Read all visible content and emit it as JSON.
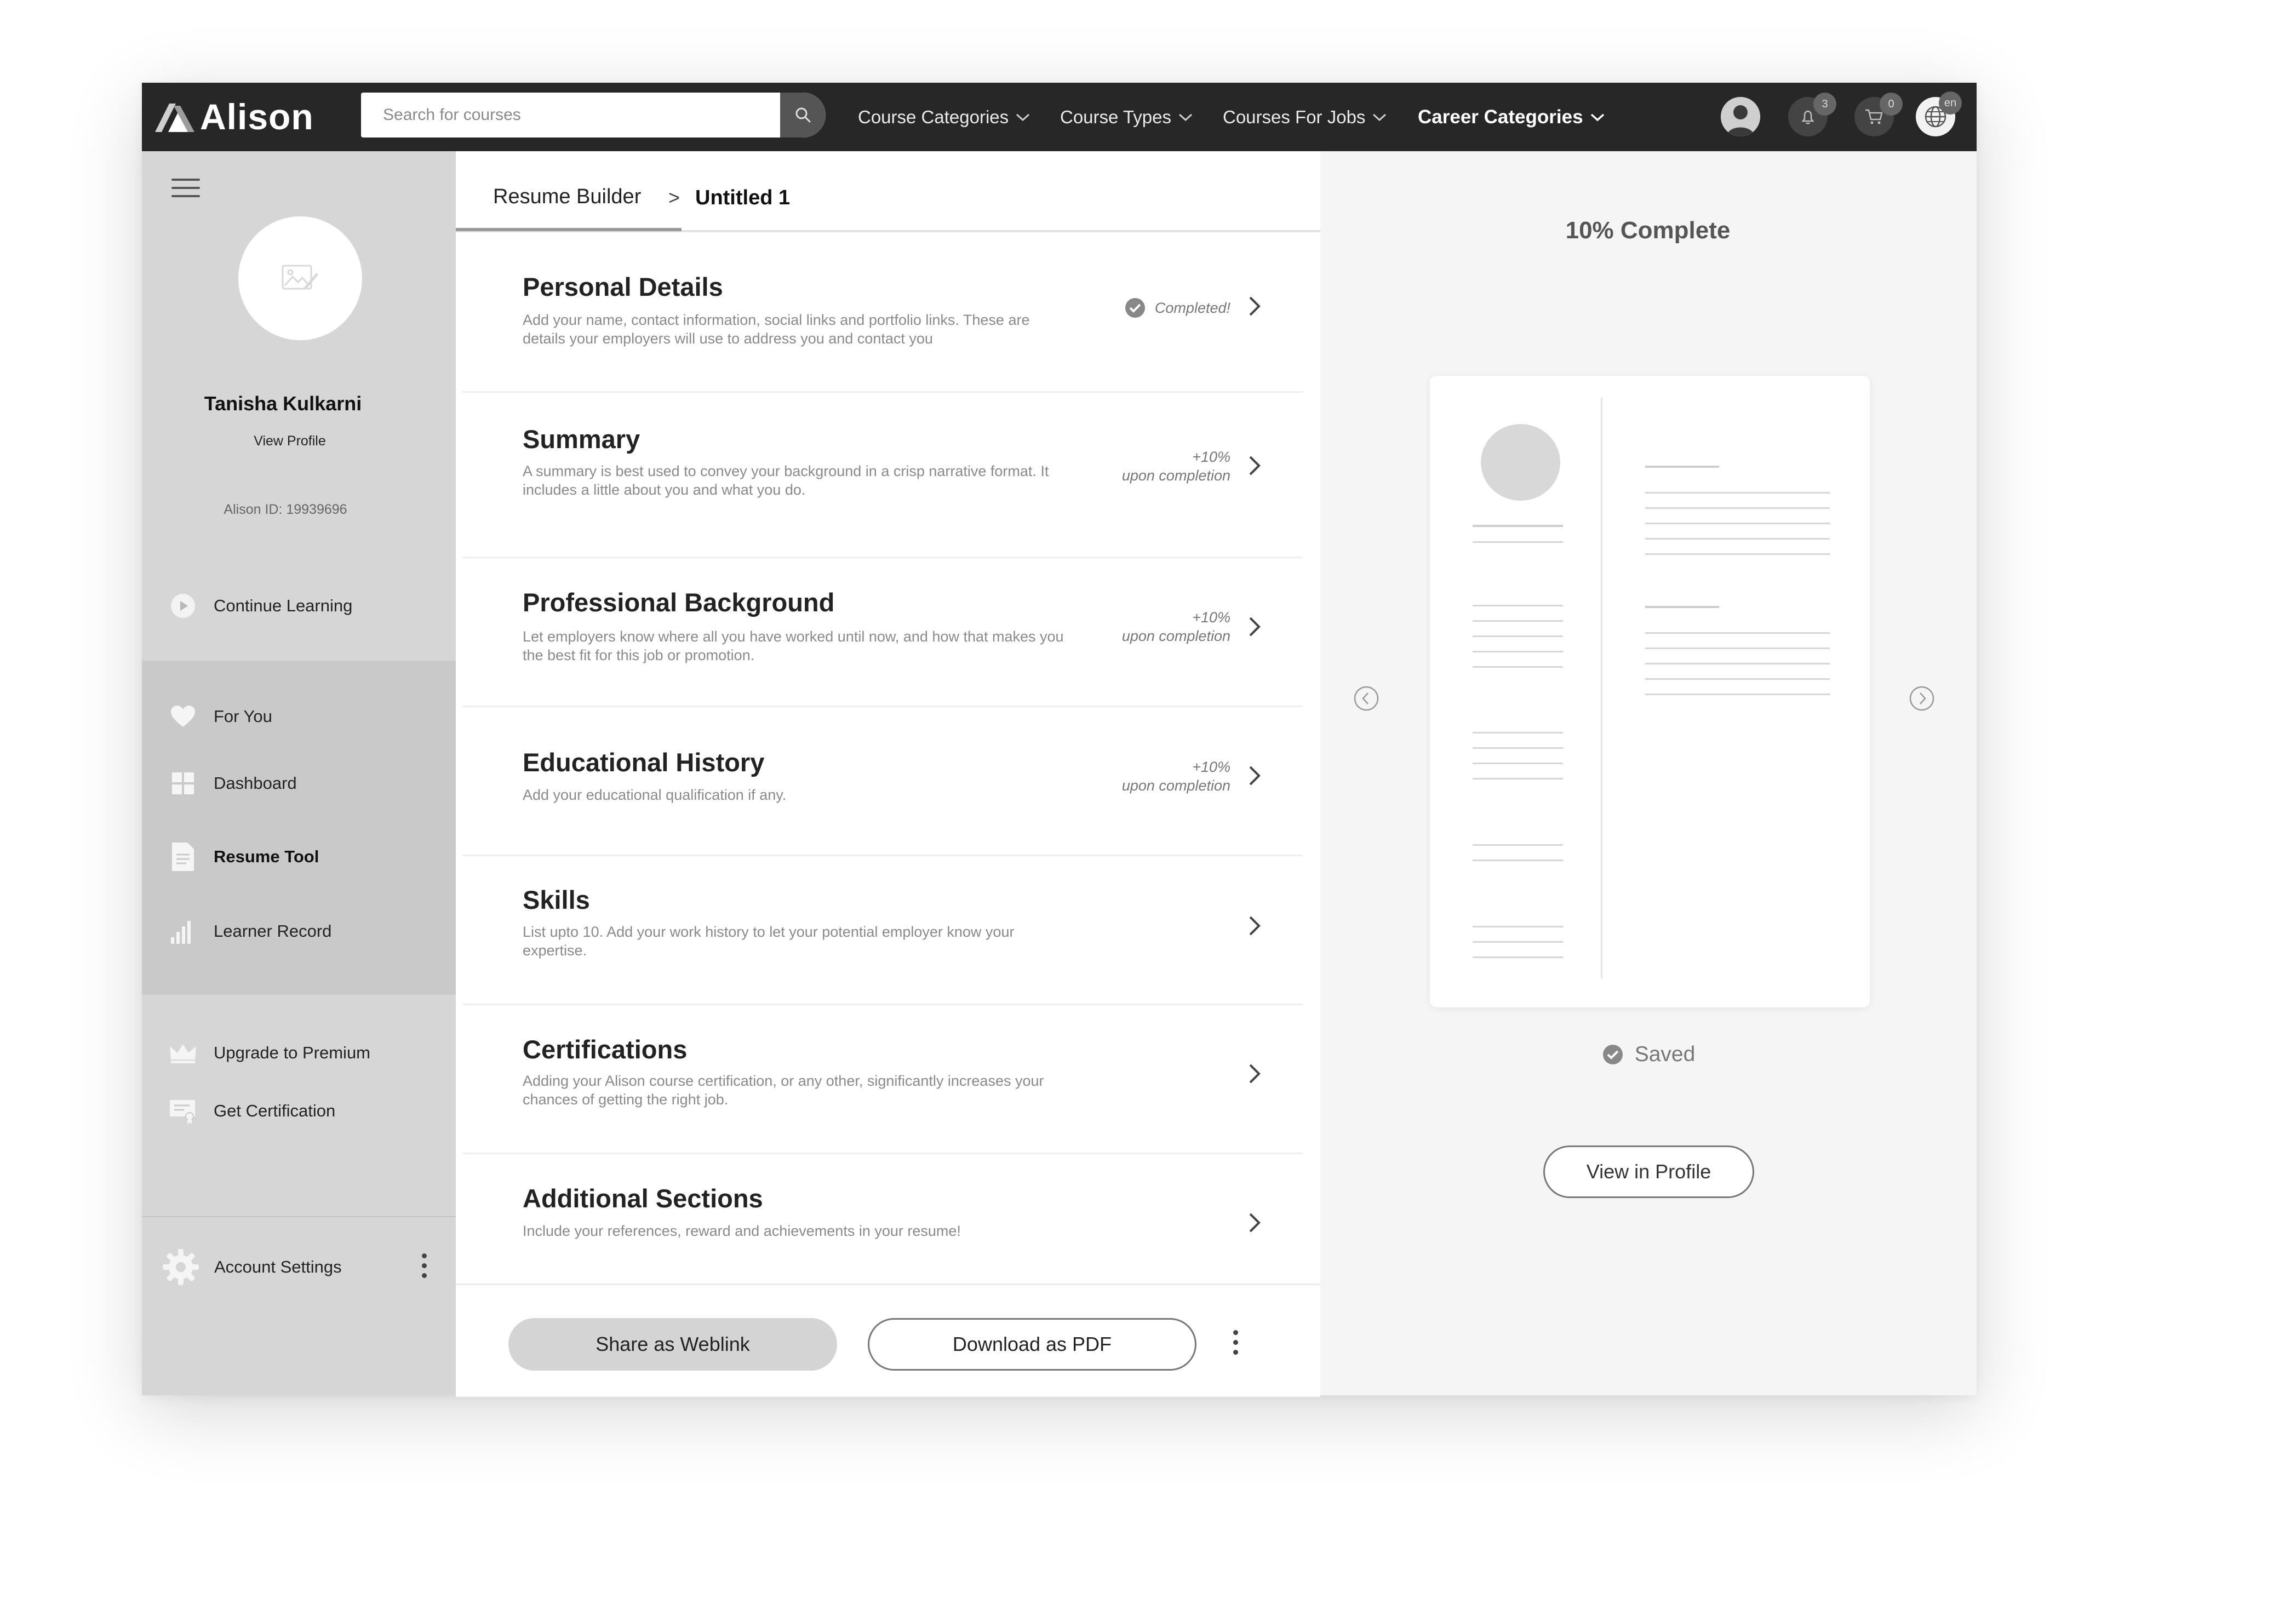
{
  "brand": {
    "name": "Alison"
  },
  "search": {
    "placeholder": "Search for courses"
  },
  "nav": [
    {
      "label": "Course Categories"
    },
    {
      "label": "Course Types"
    },
    {
      "label": "Courses For Jobs"
    },
    {
      "label": "Career Categories"
    }
  ],
  "topbar": {
    "notifications_count": "3",
    "cart_count": "0",
    "language": "en"
  },
  "profile": {
    "name": "Tanisha Kulkarni",
    "view_profile": "View Profile",
    "alison_id": "Alison ID: 19939696"
  },
  "sidebar": {
    "continue": "Continue Learning",
    "items": [
      {
        "label": "For You",
        "icon": "heart-icon"
      },
      {
        "label": "Dashboard",
        "icon": "grid-icon"
      },
      {
        "label": "Resume Tool",
        "icon": "document-icon",
        "active": true
      },
      {
        "label": "Learner Record",
        "icon": "bar-chart-icon"
      }
    ],
    "upgrade": "Upgrade to Premium",
    "certification": "Get Certification",
    "settings": "Account Settings"
  },
  "breadcrumb": {
    "root": "Resume Builder",
    "sep": ">",
    "current": "Untitled 1"
  },
  "sections": [
    {
      "title": "Personal Details",
      "desc": "Add your name, contact information, social links and portfolio links. These are details your employers will use to address you and contact you",
      "status": "Completed!"
    },
    {
      "title": "Summary",
      "desc": "A summary is best used to convey your background in a crisp narrative format. It includes a little about you and what you do.",
      "plus": "+10%",
      "note": "upon completion"
    },
    {
      "title": "Professional Background",
      "desc": "Let employers know where all you have worked until now, and how that makes you the best fit for this job or promotion.",
      "plus": "+10%",
      "note": "upon completion"
    },
    {
      "title": "Educational History",
      "desc": "Add your educational qualification if any.",
      "plus": "+10%",
      "note": "upon completion"
    },
    {
      "title": "Skills",
      "desc": "List upto 10. Add your work history to let your potential employer know your expertise."
    },
    {
      "title": "Certifications",
      "desc": "Adding your Alison course certification, or any other, significantly increases your chances of getting the right job."
    },
    {
      "title": "Additional Sections",
      "desc": "Include your references, reward and achievements in your resume!"
    }
  ],
  "footer": {
    "share": "Share as Weblink",
    "download": "Download as PDF"
  },
  "preview": {
    "progress": "10% Complete",
    "progress_value": 10,
    "saved": "Saved",
    "view_in_profile": "View in Profile"
  }
}
